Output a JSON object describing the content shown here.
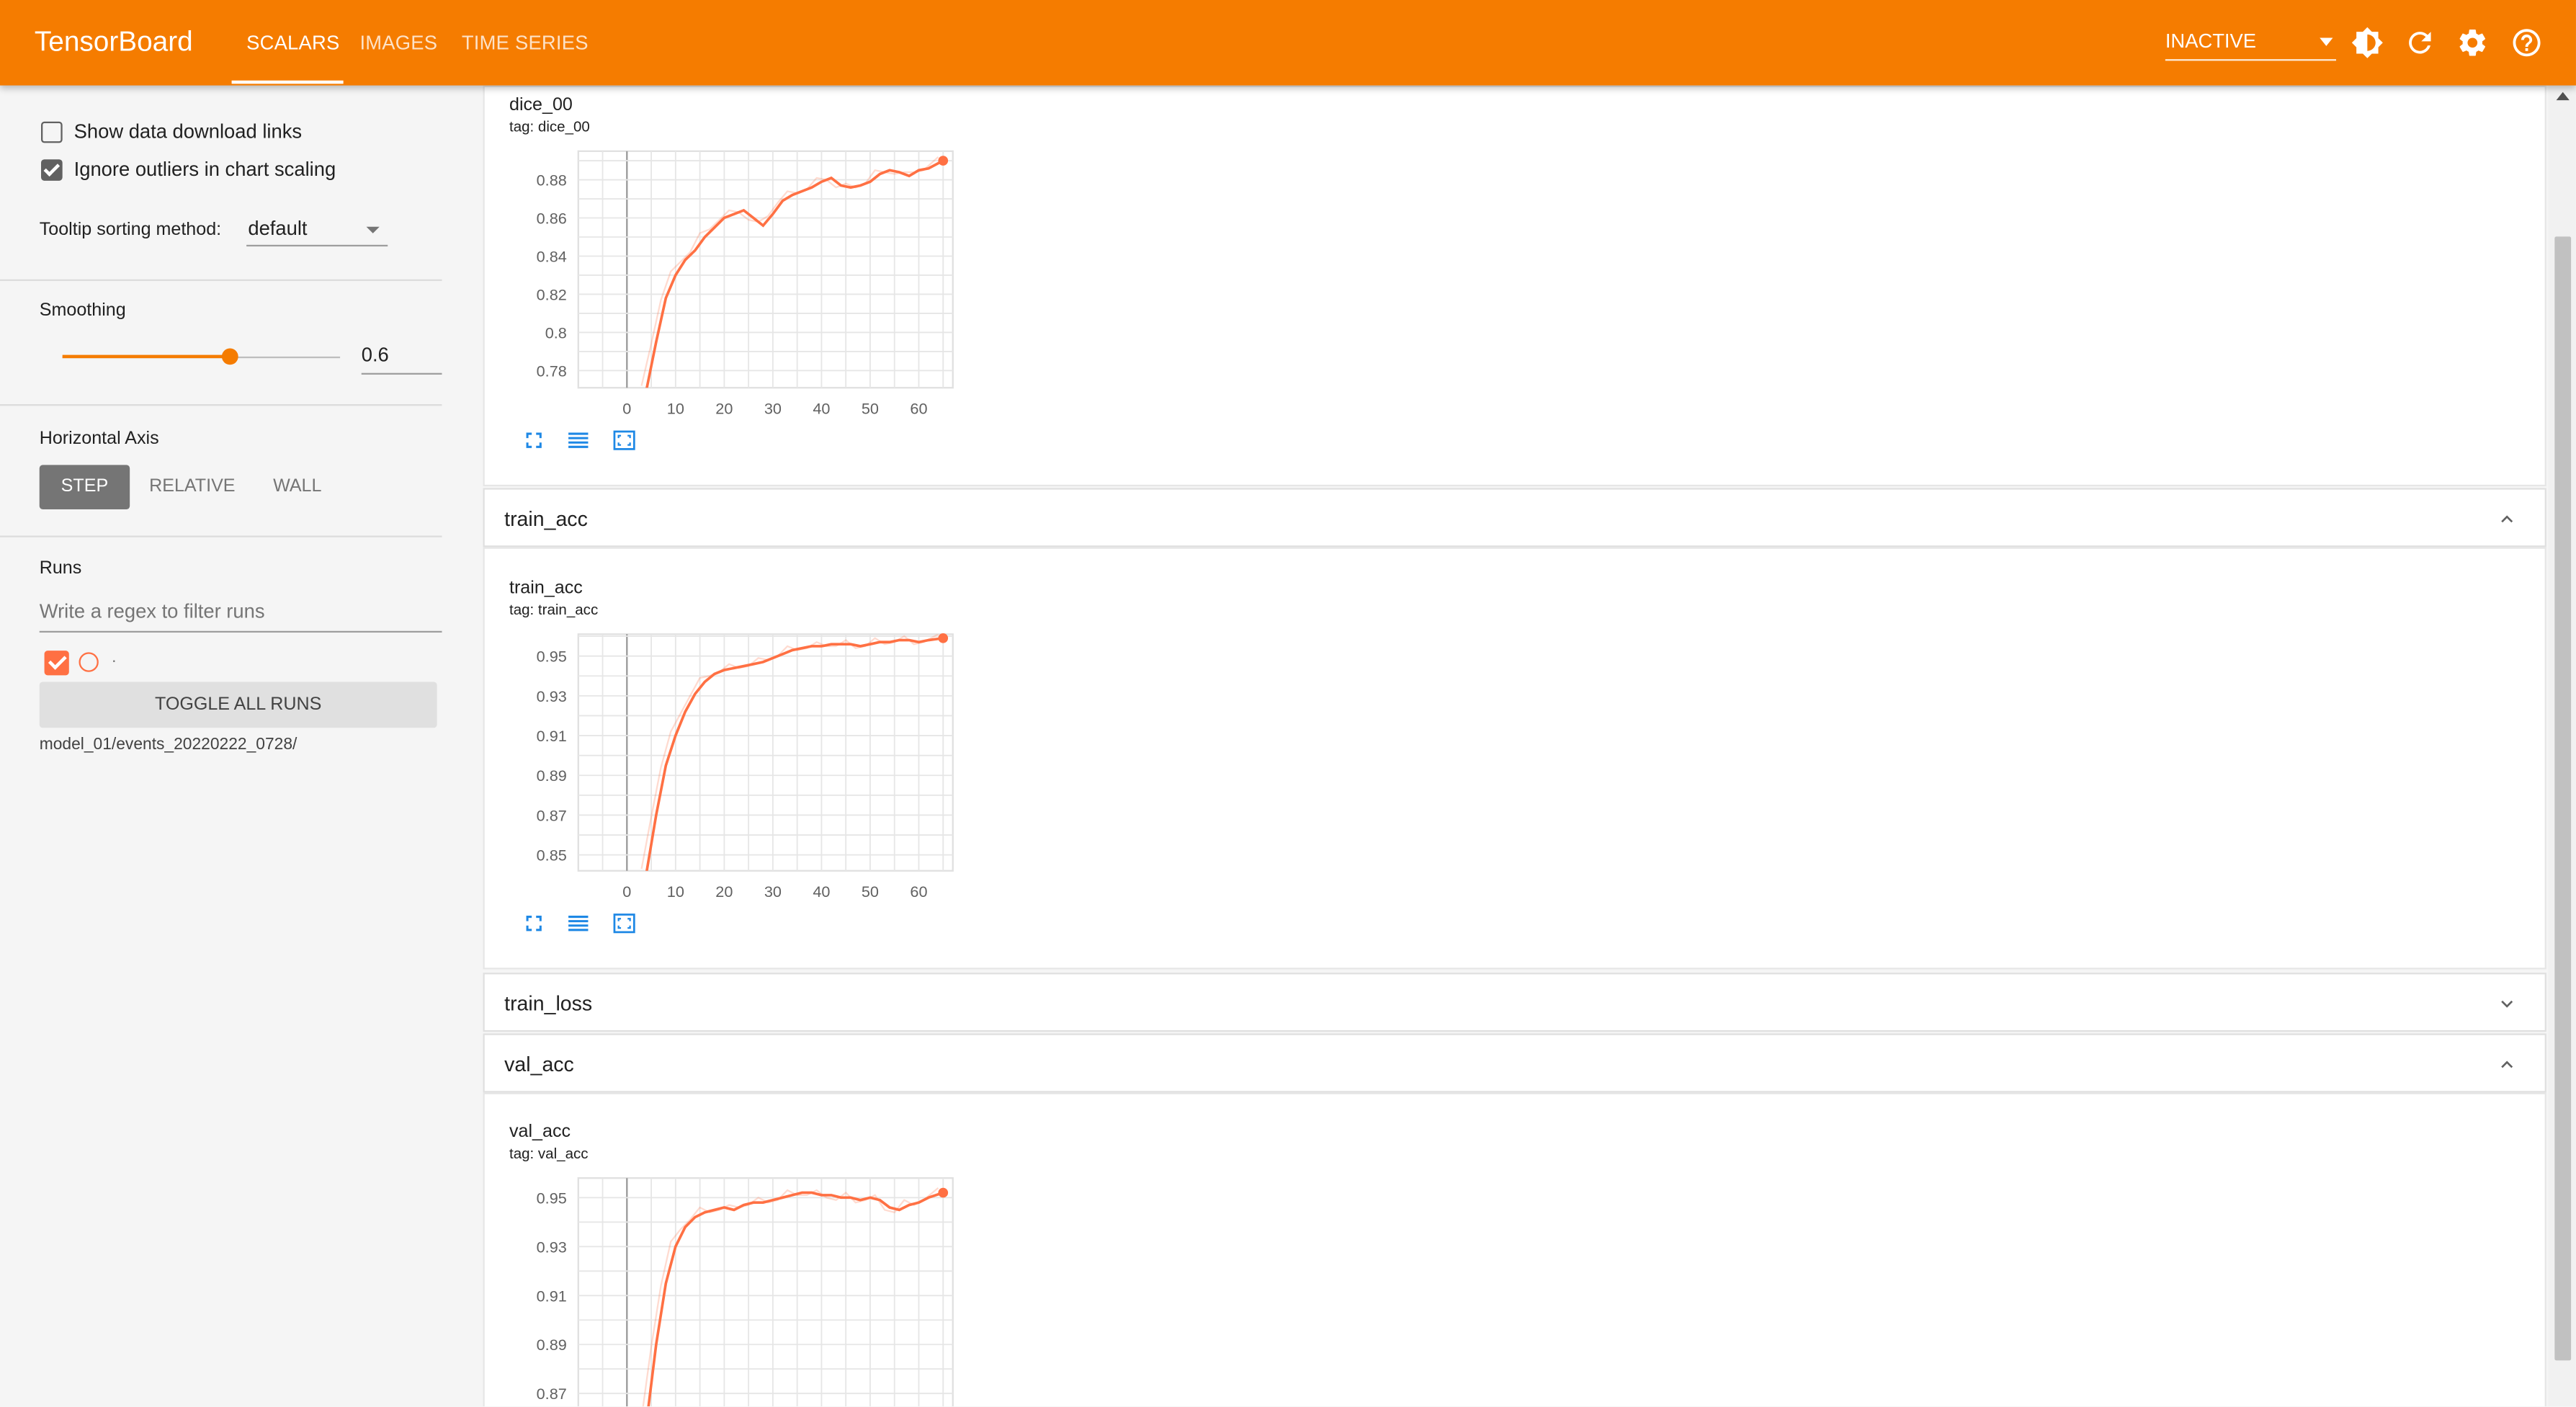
{
  "header": {
    "brand": "TensorBoard",
    "tabs": [
      {
        "label": "SCALARS",
        "active": true
      },
      {
        "label": "IMAGES",
        "active": false
      },
      {
        "label": "TIME SERIES",
        "active": false
      }
    ],
    "status_select": "INACTIVE",
    "icons": [
      "brightness-icon",
      "refresh-icon",
      "settings-icon",
      "help-icon"
    ],
    "colors": {
      "bar": "#f57c00",
      "series": "#ff7043"
    }
  },
  "sidebar": {
    "show_download_links": {
      "label": "Show data download links",
      "checked": false
    },
    "ignore_outliers": {
      "label": "Ignore outliers in chart scaling",
      "checked": true
    },
    "tooltip_sorting": {
      "label": "Tooltip sorting method:",
      "value": "default"
    },
    "smoothing": {
      "label": "Smoothing",
      "value": "0.6",
      "level": 0.6
    },
    "horizontal_axis": {
      "label": "Horizontal Axis",
      "options": [
        "STEP",
        "RELATIVE",
        "WALL"
      ],
      "selected": "STEP"
    },
    "runs": {
      "label": "Runs",
      "filter_placeholder": "Write a regex to filter runs",
      "run_label": ".",
      "toggle_all": "TOGGLE ALL RUNS",
      "run_path": "model_01/events_20220222_0728/"
    }
  },
  "main": {
    "sections": [
      {
        "title": "train_acc",
        "expanded": true
      },
      {
        "title": "train_loss",
        "expanded": false
      },
      {
        "title": "val_acc",
        "expanded": true
      }
    ],
    "cards": [
      {
        "title": "dice_00",
        "tag": "tag: dice_00"
      },
      {
        "title": "train_acc",
        "tag": "tag: train_acc"
      },
      {
        "title": "val_acc",
        "tag": "tag: val_acc"
      }
    ]
  },
  "chart_data": [
    {
      "type": "line",
      "title": "dice_00",
      "x_ticks": [
        "0",
        "10",
        "20",
        "30",
        "40",
        "50",
        "60"
      ],
      "y_ticks": [
        "0.78",
        "0.8",
        "0.82",
        "0.84",
        "0.86",
        "0.88"
      ],
      "xlim": [
        -10,
        67
      ],
      "ylim": [
        0.771,
        0.895
      ],
      "series": [
        {
          "x": [
            4,
            6,
            8,
            10,
            12,
            14,
            16,
            18,
            20,
            22,
            24,
            26,
            28,
            30,
            32,
            34,
            36,
            38,
            40,
            42,
            44,
            46,
            48,
            50,
            52,
            54,
            56,
            58,
            60,
            62,
            65
          ],
          "y": [
            0.77,
            0.795,
            0.818,
            0.83,
            0.838,
            0.843,
            0.85,
            0.855,
            0.86,
            0.862,
            0.864,
            0.86,
            0.856,
            0.862,
            0.869,
            0.872,
            0.874,
            0.876,
            0.879,
            0.881,
            0.877,
            0.876,
            0.877,
            0.879,
            0.883,
            0.885,
            0.884,
            0.882,
            0.885,
            0.886,
            0.89
          ]
        }
      ]
    },
    {
      "type": "line",
      "title": "train_acc",
      "x_ticks": [
        "0",
        "10",
        "20",
        "30",
        "40",
        "50",
        "60"
      ],
      "y_ticks": [
        "0.85",
        "0.87",
        "0.89",
        "0.91",
        "0.93",
        "0.95"
      ],
      "xlim": [
        -10,
        67
      ],
      "ylim": [
        0.842,
        0.961
      ],
      "series": [
        {
          "x": [
            4,
            6,
            8,
            10,
            12,
            14,
            16,
            18,
            20,
            22,
            24,
            26,
            28,
            30,
            32,
            34,
            36,
            38,
            40,
            42,
            44,
            46,
            48,
            50,
            52,
            54,
            56,
            58,
            60,
            62,
            65
          ],
          "y": [
            0.841,
            0.87,
            0.895,
            0.91,
            0.922,
            0.931,
            0.937,
            0.941,
            0.943,
            0.944,
            0.945,
            0.946,
            0.947,
            0.949,
            0.951,
            0.953,
            0.954,
            0.955,
            0.955,
            0.956,
            0.956,
            0.956,
            0.955,
            0.956,
            0.957,
            0.957,
            0.958,
            0.958,
            0.957,
            0.958,
            0.959
          ]
        }
      ]
    },
    {
      "type": "line",
      "title": "val_acc",
      "x_ticks": [],
      "y_ticks": [
        "0.87",
        "0.89",
        "0.91",
        "0.93",
        "0.95"
      ],
      "xlim": [
        -10,
        67
      ],
      "ylim": [
        0.86,
        0.958
      ],
      "series": [
        {
          "x": [
            4,
            6,
            8,
            10,
            12,
            14,
            16,
            18,
            20,
            22,
            24,
            26,
            28,
            30,
            32,
            34,
            36,
            38,
            40,
            42,
            44,
            46,
            48,
            50,
            52,
            54,
            56,
            58,
            60,
            62,
            65
          ],
          "y": [
            0.858,
            0.89,
            0.915,
            0.93,
            0.938,
            0.942,
            0.944,
            0.945,
            0.946,
            0.945,
            0.947,
            0.948,
            0.948,
            0.949,
            0.95,
            0.951,
            0.952,
            0.952,
            0.951,
            0.951,
            0.95,
            0.95,
            0.949,
            0.95,
            0.949,
            0.946,
            0.945,
            0.947,
            0.948,
            0.95,
            0.952
          ]
        }
      ]
    }
  ]
}
